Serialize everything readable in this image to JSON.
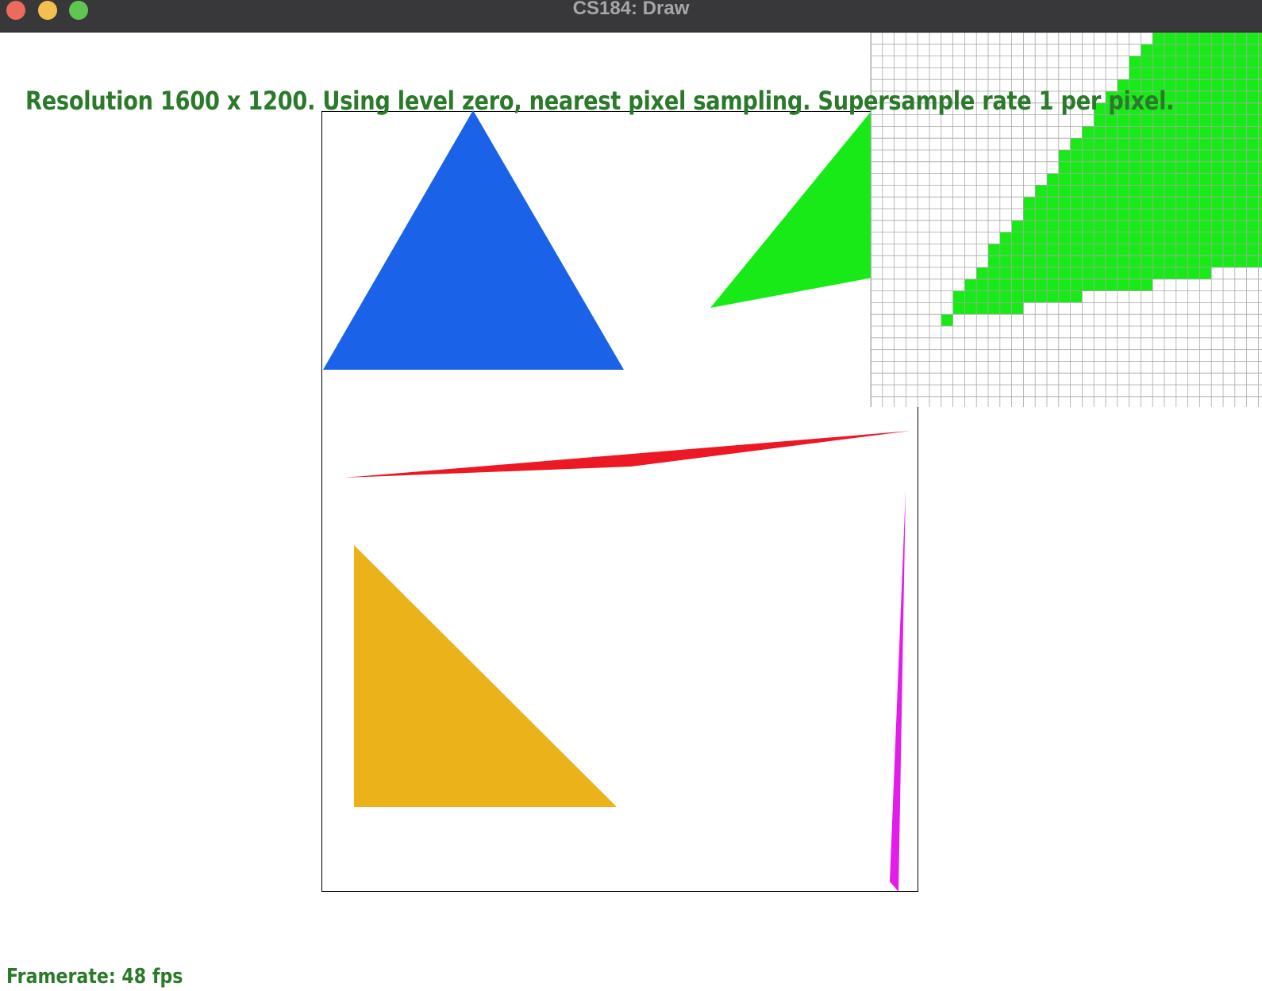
{
  "window": {
    "title": "CS184: Draw"
  },
  "overlay": {
    "status": "Resolution 1600 x 1200. Using level zero, nearest pixel sampling. Supersample rate 1 per pixel.",
    "framerate": "Framerate: 48 fps"
  },
  "colors": {
    "titlebar": "#38383a",
    "close": "#ed6a5e",
    "minimize": "#f5bf4f",
    "maximize": "#61c554",
    "overlay_text": "#2a7a2a",
    "triangle_blue": "#1a63e8",
    "triangle_green": "#18ea18",
    "triangle_red": "#ec1823",
    "triangle_yellow": "#ebb319",
    "triangle_magenta": "#e31ce9",
    "grid_line": "#a8a8a8"
  },
  "scene": {
    "shapes": [
      {
        "name": "triangle-blue",
        "color": "blue"
      },
      {
        "name": "triangle-green",
        "color": "green"
      },
      {
        "name": "triangle-red-sliver",
        "color": "red"
      },
      {
        "name": "triangle-yellow",
        "color": "yellow"
      },
      {
        "name": "triangle-magenta-sliver",
        "color": "magenta"
      }
    ],
    "zoom_inspector": {
      "sampling": "nearest pixel",
      "supersample_rate": 1
    }
  }
}
